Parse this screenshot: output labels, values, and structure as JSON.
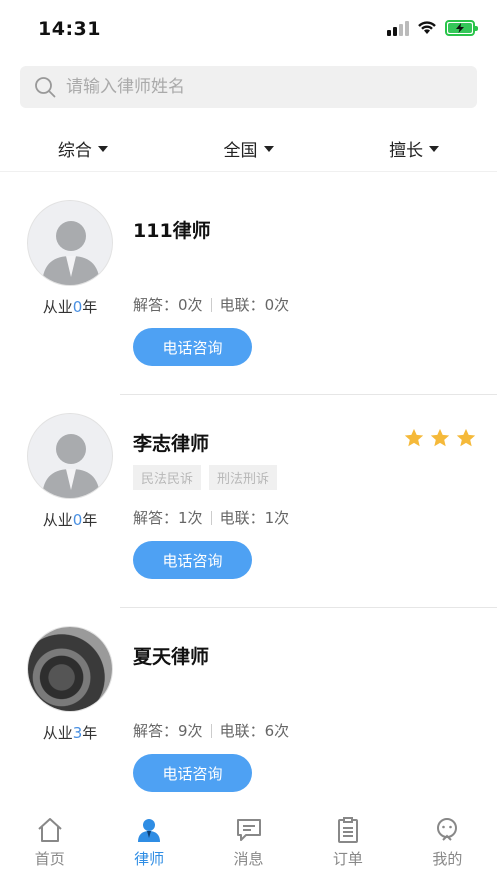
{
  "status_bar": {
    "time": "14:31"
  },
  "search": {
    "placeholder": "请输入律师姓名",
    "value": ""
  },
  "filters": [
    {
      "label": "综合"
    },
    {
      "label": "全国"
    },
    {
      "label": "擅长"
    }
  ],
  "lawyers": [
    {
      "name": "111律师",
      "years_prefix": "从业",
      "years": "0",
      "years_suffix": "年",
      "answers_label": "解答：",
      "answers": "0次",
      "calls_label": "电联：",
      "calls": "0次",
      "button": "电话咨询",
      "tags": [],
      "stars": 0,
      "avatar": "default-avatar"
    },
    {
      "name": "李志律师",
      "years_prefix": "从业",
      "years": "0",
      "years_suffix": "年",
      "answers_label": "解答：",
      "answers": "1次",
      "calls_label": "电联：",
      "calls": "1次",
      "button": "电话咨询",
      "tags": [
        "民法民诉",
        "刑法刑诉"
      ],
      "stars": 3,
      "avatar": "default-avatar"
    },
    {
      "name": "夏天律师",
      "years_prefix": "从业",
      "years": "3",
      "years_suffix": "年",
      "answers_label": "解答：",
      "answers": "9次",
      "calls_label": "电联：",
      "calls": "6次",
      "button": "电话咨询",
      "tags": [],
      "stars": 0,
      "avatar": "photo-avatar"
    }
  ],
  "bottom_nav": [
    {
      "label": "首页",
      "icon": "home-icon",
      "active": false
    },
    {
      "label": "律师",
      "icon": "lawyer-icon",
      "active": true
    },
    {
      "label": "消息",
      "icon": "message-icon",
      "active": false
    },
    {
      "label": "订单",
      "icon": "order-icon",
      "active": false
    },
    {
      "label": "我的",
      "icon": "profile-icon",
      "active": false
    }
  ],
  "colors": {
    "accent": "#2f8de4",
    "button": "#4ea1f3",
    "star": "#f5b93a",
    "years_number": "#4a90e2"
  }
}
